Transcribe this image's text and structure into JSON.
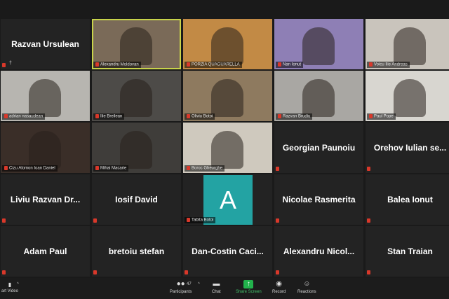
{
  "participants": [
    {
      "id": "p1",
      "name": "Razvan Ursulean",
      "label": "",
      "video": false,
      "active": false,
      "pinned": true,
      "bg": "#232323"
    },
    {
      "id": "p2",
      "name": "",
      "label": "Alexandru Moldovan",
      "video": true,
      "active": true,
      "bg": "#7a6a58"
    },
    {
      "id": "p3",
      "name": "",
      "label": "PORZIA QUAGUARELLA",
      "video": true,
      "bg": "#c28a45"
    },
    {
      "id": "p4",
      "name": "",
      "label": "Nan Ionut",
      "video": true,
      "bg": "#8e7fb5"
    },
    {
      "id": "p5",
      "name": "",
      "label": "Voicu Ilie Andreas",
      "video": true,
      "bg": "#c9c4bc"
    },
    {
      "id": "p6",
      "name": "",
      "label": "adrian nasaudean",
      "video": true,
      "bg": "#b7b5b0"
    },
    {
      "id": "p7",
      "name": "",
      "label": "Ilie Breilean",
      "video": true,
      "bg": "#4d4b48"
    },
    {
      "id": "p8",
      "name": "",
      "label": "Oliviu Botoi",
      "video": true,
      "bg": "#8e7a5f"
    },
    {
      "id": "p9",
      "name": "",
      "label": "Razvan Brudiu",
      "video": true,
      "bg": "#a9a7a3"
    },
    {
      "id": "p10",
      "name": "",
      "label": "Paul Pope",
      "video": true,
      "bg": "#d8d6d0"
    },
    {
      "id": "p11",
      "name": "",
      "label": "Cizu Alomon Ioan Daniel",
      "video": true,
      "bg": "#3a2e28"
    },
    {
      "id": "p12",
      "name": "",
      "label": "Mihai Macarie",
      "video": true,
      "bg": "#3f3d3a"
    },
    {
      "id": "p13",
      "name": "",
      "label": "Boroc Gheorghe",
      "video": true,
      "bg": "#cfc9be"
    },
    {
      "id": "p14",
      "name": "Georgian Paunoiu",
      "label": "",
      "video": false,
      "bg": "#232323"
    },
    {
      "id": "p15",
      "name": "Orehov Iulian se...",
      "label": "",
      "video": false,
      "bg": "#232323"
    },
    {
      "id": "p16",
      "name": "Liviu Razvan Dr...",
      "label": "",
      "video": false,
      "bg": "#232323"
    },
    {
      "id": "p17",
      "name": "Iosif David",
      "label": "",
      "video": false,
      "bg": "#232323"
    },
    {
      "id": "p18",
      "name": "",
      "label": "Tabita Botoi",
      "video": false,
      "avatar": "A",
      "bg": "#232323"
    },
    {
      "id": "p19",
      "name": "Nicolae Rasmerita",
      "label": "",
      "video": false,
      "bg": "#232323"
    },
    {
      "id": "p20",
      "name": "Balea Ionut",
      "label": "",
      "video": false,
      "bg": "#232323"
    },
    {
      "id": "p21",
      "name": "Adam Paul",
      "label": "",
      "video": false,
      "bg": "#232323"
    },
    {
      "id": "p22",
      "name": "bretoiu stefan",
      "label": "",
      "video": false,
      "bg": "#232323"
    },
    {
      "id": "p23",
      "name": "Dan-Costin  Caci...",
      "label": "",
      "video": false,
      "bg": "#232323"
    },
    {
      "id": "p24",
      "name": "Alexandru  Nicol...",
      "label": "",
      "video": false,
      "bg": "#232323"
    },
    {
      "id": "p25",
      "name": "Stan Traian",
      "label": "",
      "video": false,
      "bg": "#232323"
    }
  ],
  "toolbar": {
    "start_video": "art Video",
    "participants_count": "47",
    "participants": "Participants",
    "chat": "Chat",
    "share_screen": "Share Screen",
    "record": "Record",
    "reactions": "Reactions"
  },
  "colors": {
    "active_outline": "#c8d34a",
    "mic_muted": "#d9382a",
    "share_green": "#22b24c",
    "avatar_bg": "#23a3a3"
  }
}
